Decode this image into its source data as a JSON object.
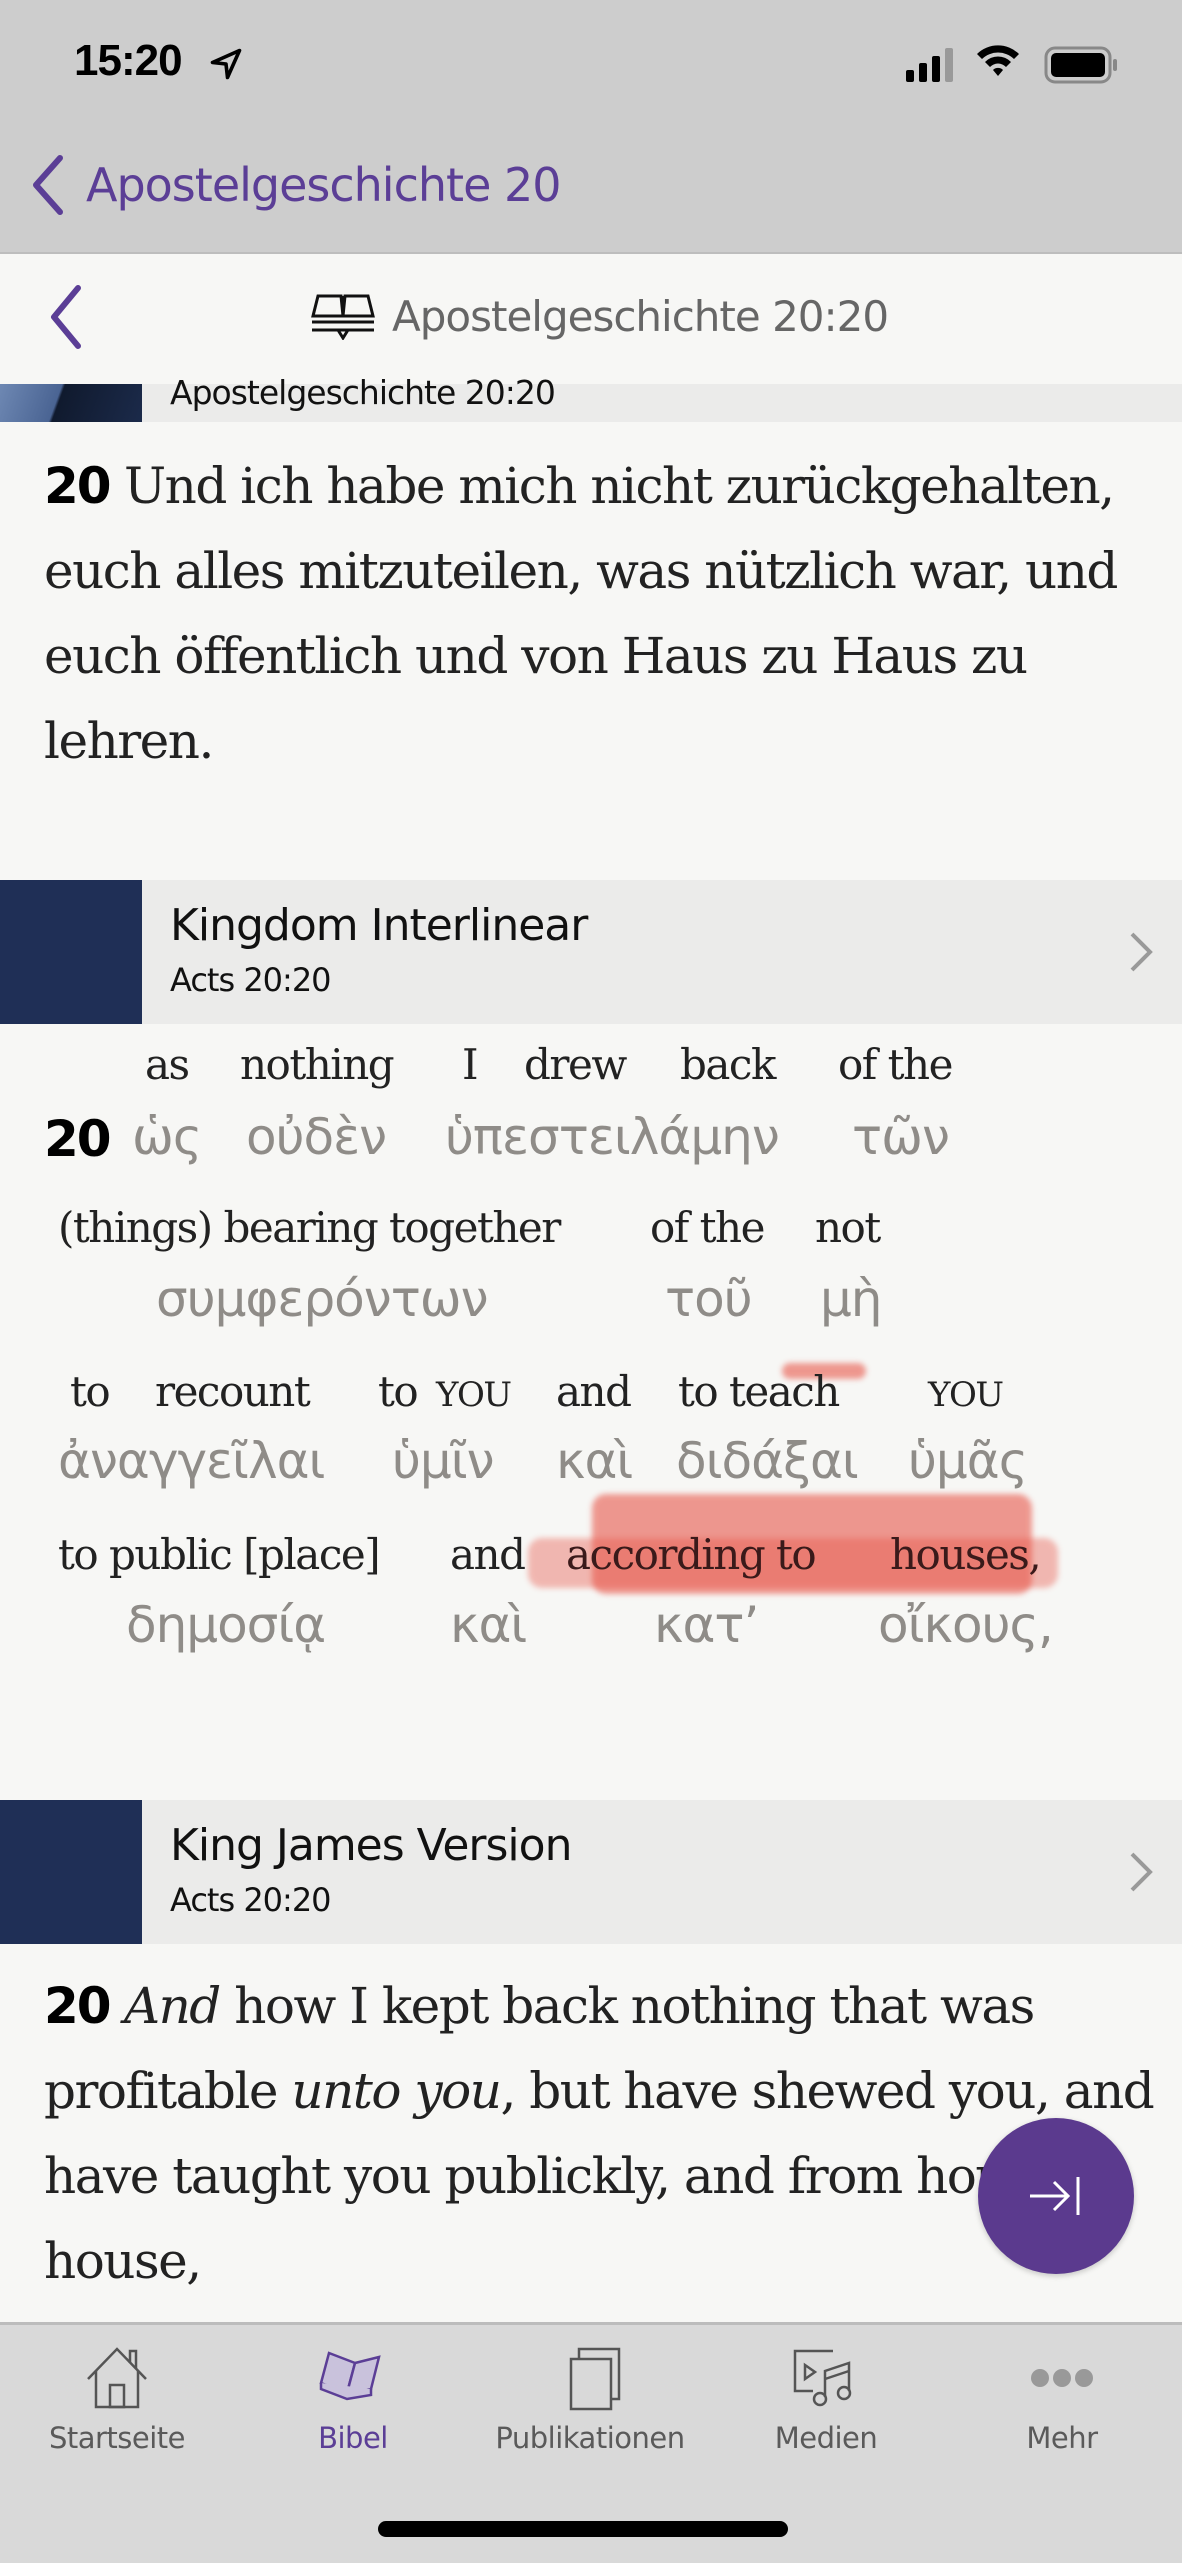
{
  "status_bar": {
    "time": "15:20",
    "location_icon": "location-arrow-icon",
    "signal_icon": "cellular-signal-icon",
    "wifi_icon": "wifi-icon",
    "battery_icon": "battery-icon"
  },
  "nav": {
    "back_label": "Apostelgeschichte 20",
    "back_icon": "chevron-left-icon"
  },
  "sub_header": {
    "title": "Apostelgeschichte 20:20",
    "icon": "open-bible-icon",
    "back_icon": "chevron-left-icon"
  },
  "sections": [
    {
      "thumb_label": "Apostelgeschichte 20:20",
      "verse_number": "20",
      "text": "Und ich habe mich nicht zurückgehalten, euch alles mitzuteilen, was nützlich war, und euch öffentlich und von Haus zu Haus zu lehren."
    },
    {
      "title": "Kingdom Interlinear",
      "subtitle": "Acts 20:20",
      "verse_number": "20",
      "interlinear": {
        "row1_en": [
          "as",
          "nothing",
          "I",
          "drew",
          "back",
          "of the"
        ],
        "row1_gr": [
          "ὡς",
          "οὐδὲν",
          "ὑπεστειλάμην",
          "τῶν"
        ],
        "row2_en": [
          "(things) bearing together",
          "of the",
          "not"
        ],
        "row2_gr": [
          "συμφερόντων",
          "τοῦ",
          "μὴ"
        ],
        "row3_en": [
          "to",
          "recount",
          "to",
          "YOU",
          "and",
          "to teach",
          "YOU"
        ],
        "row3_gr": [
          "ἀναγγεῖλαι",
          "ὑμῖν",
          "καὶ",
          "διδάξαι",
          "ὑμᾶς"
        ],
        "row4_en": [
          "to public [place]",
          "and",
          "according to",
          "houses,"
        ],
        "row4_gr": [
          "δημοσίᾳ",
          "καὶ",
          "κατ’",
          "οἴκους,"
        ]
      }
    },
    {
      "title": "King James Version",
      "subtitle": "Acts 20:20",
      "verse_number": "20",
      "text_parts": {
        "i1": "And",
        "t1": " how I kept back nothing that was profitable ",
        "i2": "unto you",
        "t2": ", but have shewed you, and have taught you publickly, and from house to house,"
      }
    }
  ],
  "fab": {
    "icon": "arrow-to-right-bar-icon"
  },
  "tab_bar": {
    "items": [
      {
        "label": "Startseite",
        "icon": "home-icon",
        "active": false
      },
      {
        "label": "Bibel",
        "icon": "bible-icon",
        "active": true
      },
      {
        "label": "Publikationen",
        "icon": "publications-icon",
        "active": false
      },
      {
        "label": "Medien",
        "icon": "media-icon",
        "active": false
      },
      {
        "label": "Mehr",
        "icon": "more-dots-icon",
        "active": false
      }
    ]
  },
  "colors": {
    "accent": "#5b3e96",
    "fab": "#5b3a8e",
    "thumbnail": "#1f2f56",
    "highlight": "#e8574a"
  }
}
